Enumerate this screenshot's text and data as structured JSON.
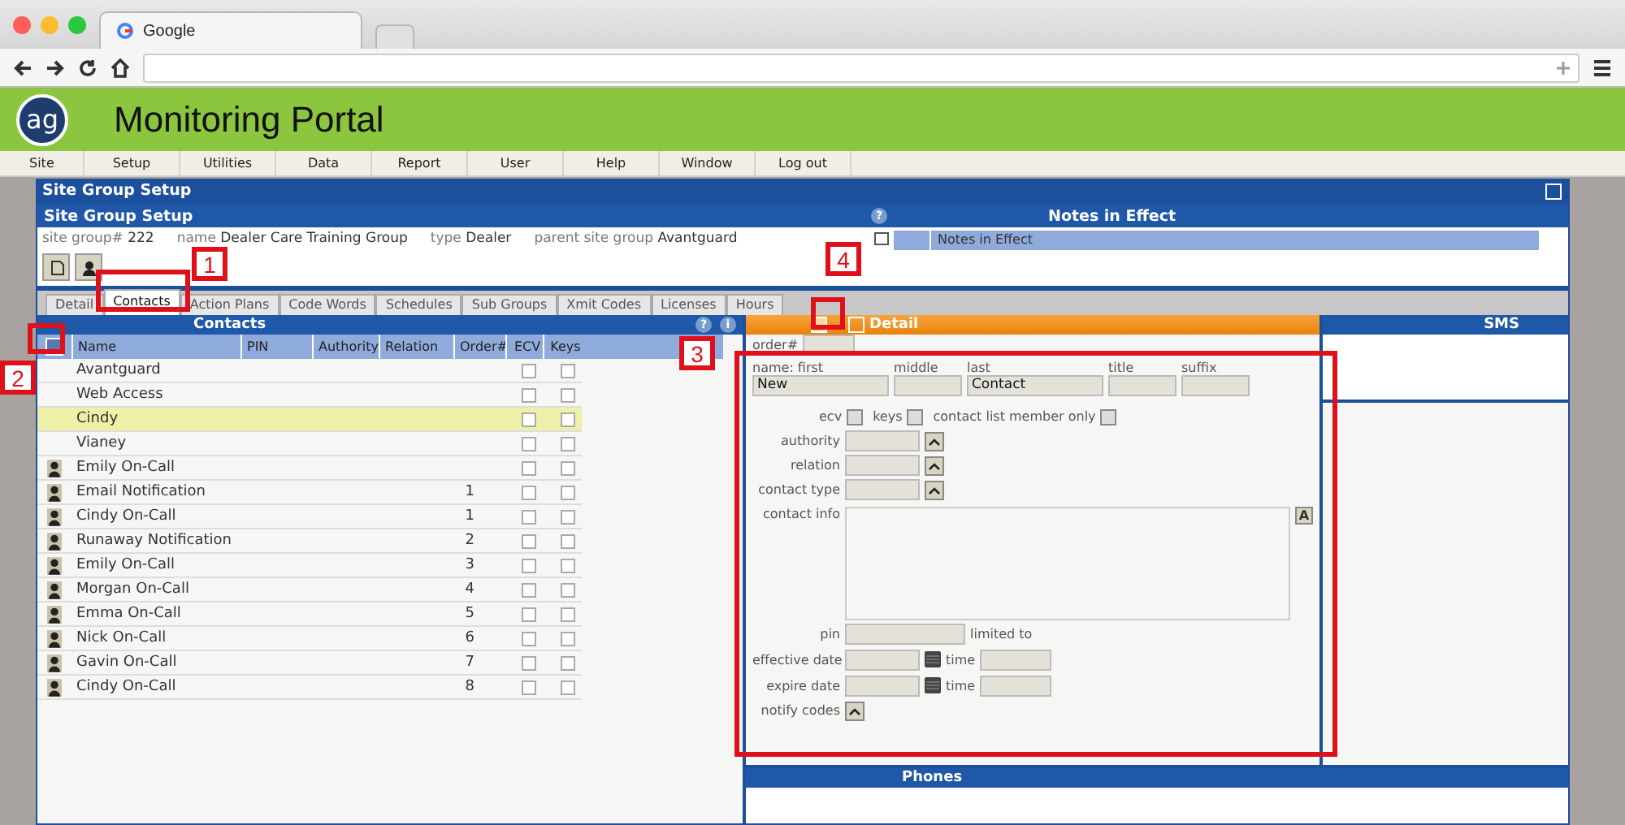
{
  "browser": {
    "tab_title": "Google"
  },
  "header": {
    "logo": "ag",
    "title": "Monitoring Portal"
  },
  "menu": [
    "Site",
    "Setup",
    "Utilities",
    "Data",
    "Report",
    "User",
    "Help",
    "Window",
    "Log out"
  ],
  "window": {
    "title": "Site Group Setup",
    "subtitle": "Site Group Setup"
  },
  "info": [
    {
      "label": "site group#",
      "value": "222"
    },
    {
      "label": "name",
      "value": "Dealer Care Training Group"
    },
    {
      "label": "type",
      "value": "Dealer"
    },
    {
      "label": "parent site group",
      "value": "Avantguard"
    }
  ],
  "notes": {
    "title": "Notes in Effect",
    "column": "Notes in Effect"
  },
  "tabs": [
    {
      "label": "Detail",
      "selected": false
    },
    {
      "label": "Contacts",
      "selected": true
    },
    {
      "label": "Action Plans",
      "selected": false
    },
    {
      "label": "Code Words",
      "selected": false
    },
    {
      "label": "Schedules",
      "selected": false
    },
    {
      "label": "Sub Groups",
      "selected": false
    },
    {
      "label": "Xmit Codes",
      "selected": false
    },
    {
      "label": "Licenses",
      "selected": false
    },
    {
      "label": "Hours",
      "selected": false
    }
  ],
  "contacts": {
    "title": "Contacts",
    "help": "?",
    "info": "i",
    "columns": [
      "Name",
      "PIN",
      "Authority",
      "Relation",
      "Order#",
      "ECV",
      "Keys"
    ],
    "rows": [
      {
        "kind": "plain",
        "name": "Avantguard",
        "order": "",
        "selected": false,
        "ecv": false,
        "keys": false
      },
      {
        "kind": "plain",
        "name": "Web Access",
        "order": "",
        "selected": false,
        "ecv": false,
        "keys": false
      },
      {
        "kind": "plain",
        "name": "Cindy",
        "order": "",
        "selected": true,
        "ecv": false,
        "keys": false
      },
      {
        "kind": "plain",
        "name": "Vianey",
        "order": "",
        "selected": false,
        "ecv": false,
        "keys": false
      },
      {
        "kind": "person",
        "name": "Emily On-Call",
        "order": "",
        "selected": false,
        "ecv": false,
        "keys": false
      },
      {
        "kind": "person",
        "name": "Email Notification",
        "order": "1",
        "selected": false,
        "ecv": false,
        "keys": false
      },
      {
        "kind": "person",
        "name": "Cindy On-Call",
        "order": "1",
        "selected": false,
        "ecv": false,
        "keys": false
      },
      {
        "kind": "person",
        "name": "Runaway Notification",
        "order": "2",
        "selected": false,
        "ecv": false,
        "keys": false
      },
      {
        "kind": "person",
        "name": "Emily On-Call",
        "order": "3",
        "selected": false,
        "ecv": false,
        "keys": false
      },
      {
        "kind": "person",
        "name": "Morgan On-Call",
        "order": "4",
        "selected": false,
        "ecv": false,
        "keys": false
      },
      {
        "kind": "person",
        "name": "Emma On-Call",
        "order": "5",
        "selected": false,
        "ecv": false,
        "keys": false
      },
      {
        "kind": "person",
        "name": "Nick On-Call",
        "order": "6",
        "selected": false,
        "ecv": false,
        "keys": false
      },
      {
        "kind": "person",
        "name": "Gavin On-Call",
        "order": "7",
        "selected": false,
        "ecv": false,
        "keys": false
      },
      {
        "kind": "person",
        "name": "Cindy On-Call",
        "order": "8",
        "selected": false,
        "ecv": false,
        "keys": false
      }
    ]
  },
  "detail": {
    "title": "Detail",
    "order_label": "order#",
    "name_fields": [
      {
        "label": "name: first",
        "value": "New"
      },
      {
        "label": "middle"
      },
      {
        "label": "last",
        "value": "Contact"
      },
      {
        "label": "title"
      },
      {
        "label": "suffix"
      }
    ],
    "checks": [
      {
        "label": "ecv",
        "checked": false
      },
      {
        "label": "keys",
        "checked": false
      },
      {
        "label": "contact list member only",
        "checked": false
      }
    ],
    "selects": [
      "authority",
      "relation",
      "contact type"
    ],
    "contact_info_label": "contact info",
    "format_button": "A",
    "pin_label": "pin",
    "limited_to": "limited to",
    "dates": [
      {
        "label": "effective date",
        "time_label": "time"
      },
      {
        "label": "expire date",
        "time_label": "time"
      }
    ],
    "notify_label": "notify codes"
  },
  "sms": {
    "title": "SMS"
  },
  "phones": {
    "title": "Phones"
  },
  "callouts": [
    "1",
    "2",
    "3",
    "4"
  ]
}
